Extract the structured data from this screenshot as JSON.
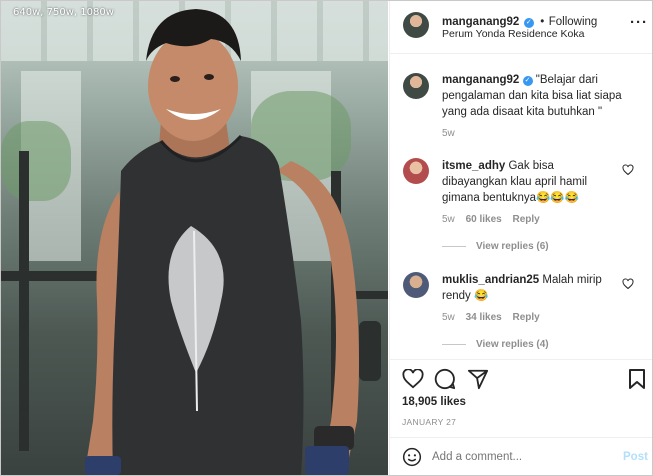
{
  "photo": {
    "size_label": "640w, 750w, 1080w"
  },
  "header": {
    "username": "manganang92",
    "follow_separator": "•",
    "follow_status": "Following",
    "location": "Perum Yonda Residence Koka",
    "more_icon": "more-icon"
  },
  "caption": {
    "username": "manganang92",
    "text_line1": "\"Belajar dari",
    "text_line2": "pengalaman dan kita bisa liat siapa",
    "text_line3": "yang ada disaat kita butuhkan \"",
    "time": "5w"
  },
  "comments": [
    {
      "username": "itsme_adhy",
      "text_line1": "Gak bisa",
      "text_line2": "dibayangkan klau april hamil",
      "text_line3": "gimana bentuknya😂😂😂",
      "time": "5w",
      "likes": "60 likes",
      "reply": "Reply",
      "view_replies": "View replies (6)"
    },
    {
      "username": "muklis_andrian25",
      "text_line1": "Malah mirip",
      "text_line2": "rendy 😂",
      "time": "5w",
      "likes": "34 likes",
      "reply": "Reply",
      "view_replies": "View replies (4)"
    }
  ],
  "actions": {
    "like_count": "18,905 likes",
    "date": "JANUARY 27"
  },
  "add_comment": {
    "placeholder": "Add a comment...",
    "post_label": "Post"
  },
  "colors": {
    "accent": "#3897f0",
    "text": "#262626",
    "muted": "#8e8e8e",
    "post_disabled": "#b2dffc"
  }
}
